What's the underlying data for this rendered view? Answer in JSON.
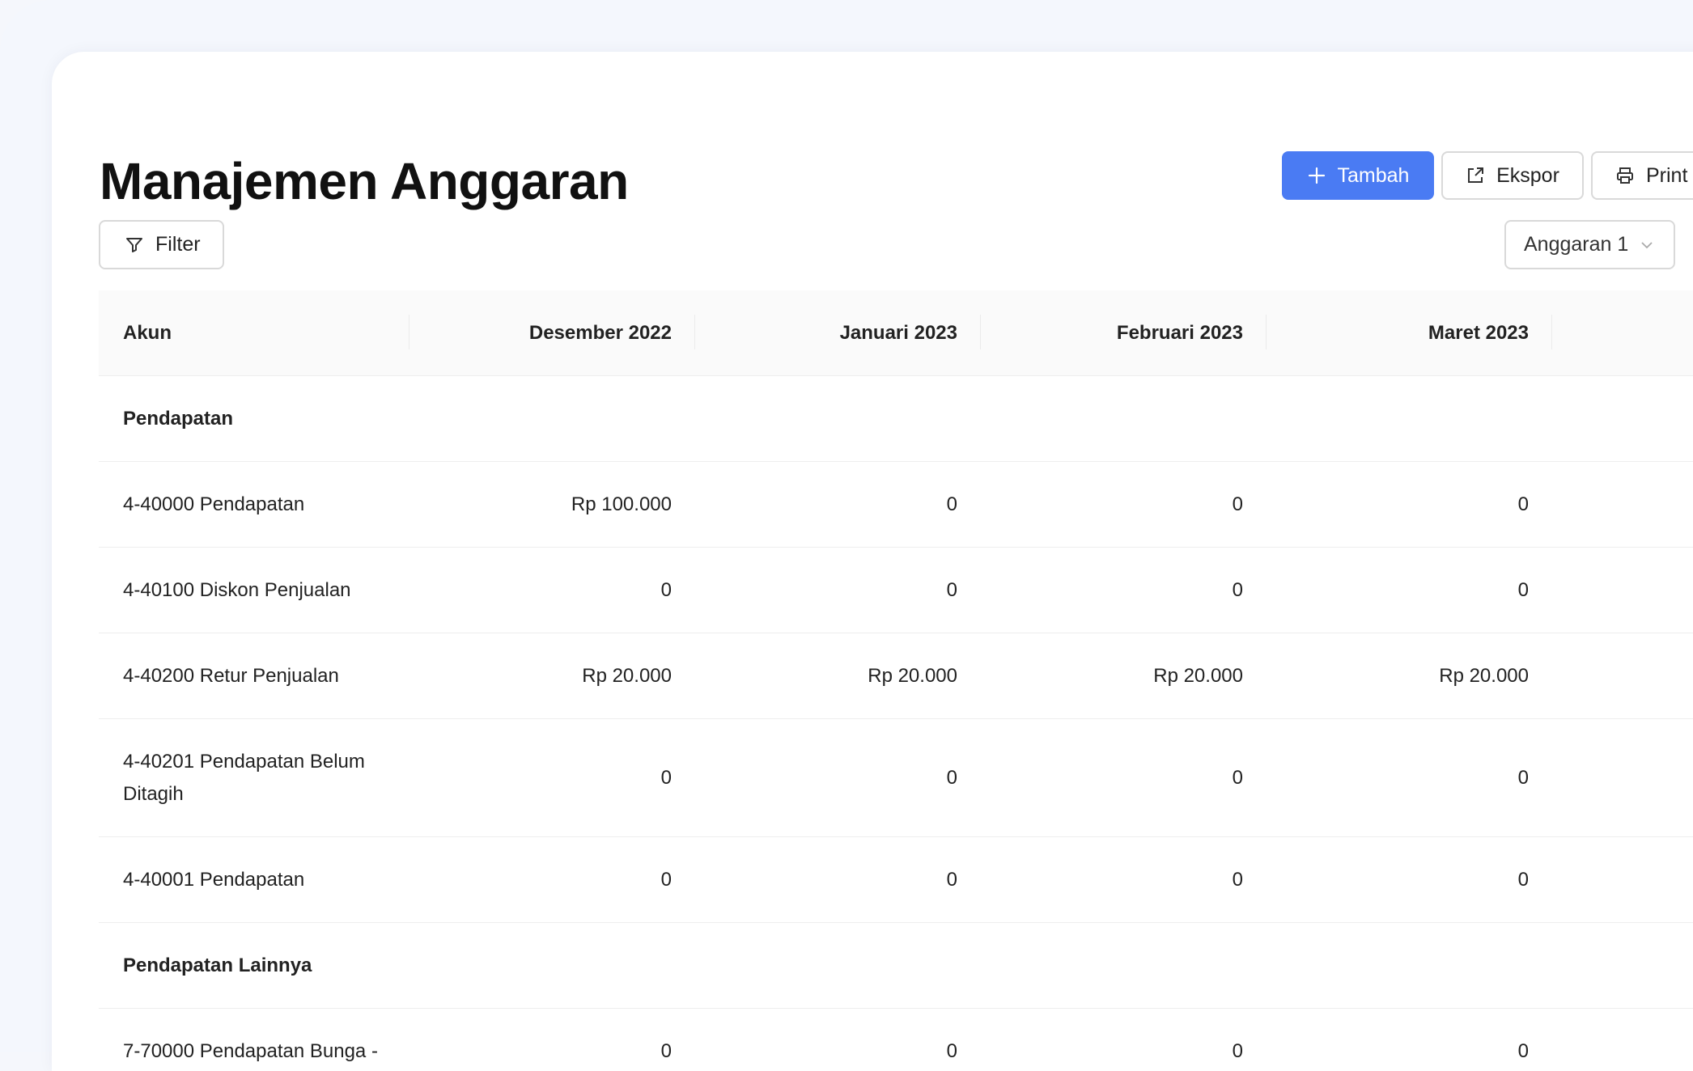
{
  "page": {
    "title": "Manajemen Anggaran"
  },
  "toolbar": {
    "add_label": "Tambah",
    "export_label": "Ekspor",
    "print_label": "Print",
    "filter_label": "Filter",
    "budget_select": "Anggaran 1"
  },
  "icons": {
    "add": "plus-icon",
    "export": "external-link-icon",
    "print": "printer-icon",
    "filter": "funnel-icon",
    "select": "chevron-down-icon"
  },
  "colors": {
    "primary": "#4a7bf3",
    "border": "#d9d9d9",
    "header_bg": "#fafafa",
    "page_bg": "#f4f7fd"
  },
  "table": {
    "columns": [
      "Akun",
      "Desember 2022",
      "Januari 2023",
      "Februari 2023",
      "Maret 2023"
    ],
    "groups": [
      {
        "name": "Pendapatan",
        "rows": [
          {
            "akun": "4-40000 Pendapatan",
            "values": [
              "Rp 100.000",
              "0",
              "0",
              "0"
            ]
          },
          {
            "akun": "4-40100 Diskon Penjualan",
            "values": [
              "0",
              "0",
              "0",
              "0"
            ]
          },
          {
            "akun": "4-40200 Retur Penjualan",
            "values": [
              "Rp 20.000",
              "Rp 20.000",
              "Rp 20.000",
              "Rp 20.000"
            ]
          },
          {
            "akun": "4-40201 Pendapatan Belum Ditagih",
            "values": [
              "0",
              "0",
              "0",
              "0"
            ]
          },
          {
            "akun": "4-40001 Pendapatan",
            "values": [
              "0",
              "0",
              "0",
              "0"
            ]
          }
        ]
      },
      {
        "name": "Pendapatan Lainnya",
        "rows": [
          {
            "akun": "7-70000 Pendapatan Bunga -",
            "values": [
              "0",
              "0",
              "0",
              "0"
            ]
          }
        ]
      }
    ]
  }
}
